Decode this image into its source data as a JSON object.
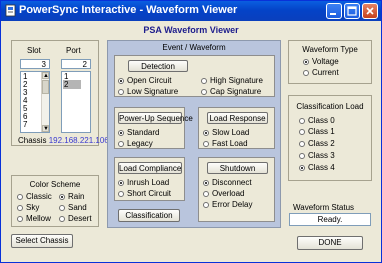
{
  "window": {
    "title": "PowerSync Interactive - Waveform Viewer"
  },
  "header": {
    "title": "PSA Waveform Viewer"
  },
  "slot_port": {
    "slot_label": "Slot",
    "port_label": "Port",
    "slot_value": "3",
    "port_value": "2",
    "slot_items": [
      "1",
      "2",
      "3",
      "4",
      "5",
      "6",
      "7"
    ],
    "port_items": [
      "1",
      "2"
    ],
    "port_selected": "2",
    "chassis_label": "Chassis",
    "chassis_ip": "192.168.221.106"
  },
  "color_scheme": {
    "title": "Color Scheme",
    "options": [
      "Classic",
      "Rain",
      "Sky",
      "Sand",
      "Mellow",
      "Desert"
    ],
    "selected": "Rain"
  },
  "buttons": {
    "select_chassis": "Select Chassis",
    "done": "DONE"
  },
  "event_waveform": {
    "title": "Event / Waveform",
    "detection": {
      "button": "Detection",
      "options": [
        "Open Circuit",
        "High Signature",
        "Low Signature",
        "Cap Signature"
      ],
      "selected": "Open Circuit"
    },
    "powerup": {
      "button": "Power-Up Sequence",
      "options": [
        "Standard",
        "Legacy"
      ],
      "selected": "Standard"
    },
    "load_response": {
      "button": "Load Response",
      "options": [
        "Slow Load",
        "Fast Load"
      ],
      "selected": "Slow Load"
    },
    "load_compliance": {
      "button": "Load Compliance",
      "options": [
        "Inrush Load",
        "Short Circuit"
      ],
      "selected": "Inrush Load"
    },
    "shutdown": {
      "button": "Shutdown",
      "options": [
        "Disconnect",
        "Overload",
        "Error Delay"
      ],
      "selected": "Disconnect"
    },
    "classification_button": "Classification"
  },
  "waveform_type": {
    "title": "Waveform Type",
    "options": [
      "Voltage",
      "Current"
    ],
    "selected": "Voltage"
  },
  "classification_load": {
    "title": "Classification Load",
    "options": [
      "Class 0",
      "Class 1",
      "Class 2",
      "Class 3",
      "Class 4"
    ],
    "selected": "Class 4"
  },
  "waveform_status": {
    "label": "Waveform Status",
    "value": "Ready."
  },
  "colors": {
    "title_bar": "#0a5ee0",
    "panel_blue": "#b9c5dd",
    "header_text": "#1d1d8c",
    "chassis_ip_text": "#3a3ad0"
  }
}
